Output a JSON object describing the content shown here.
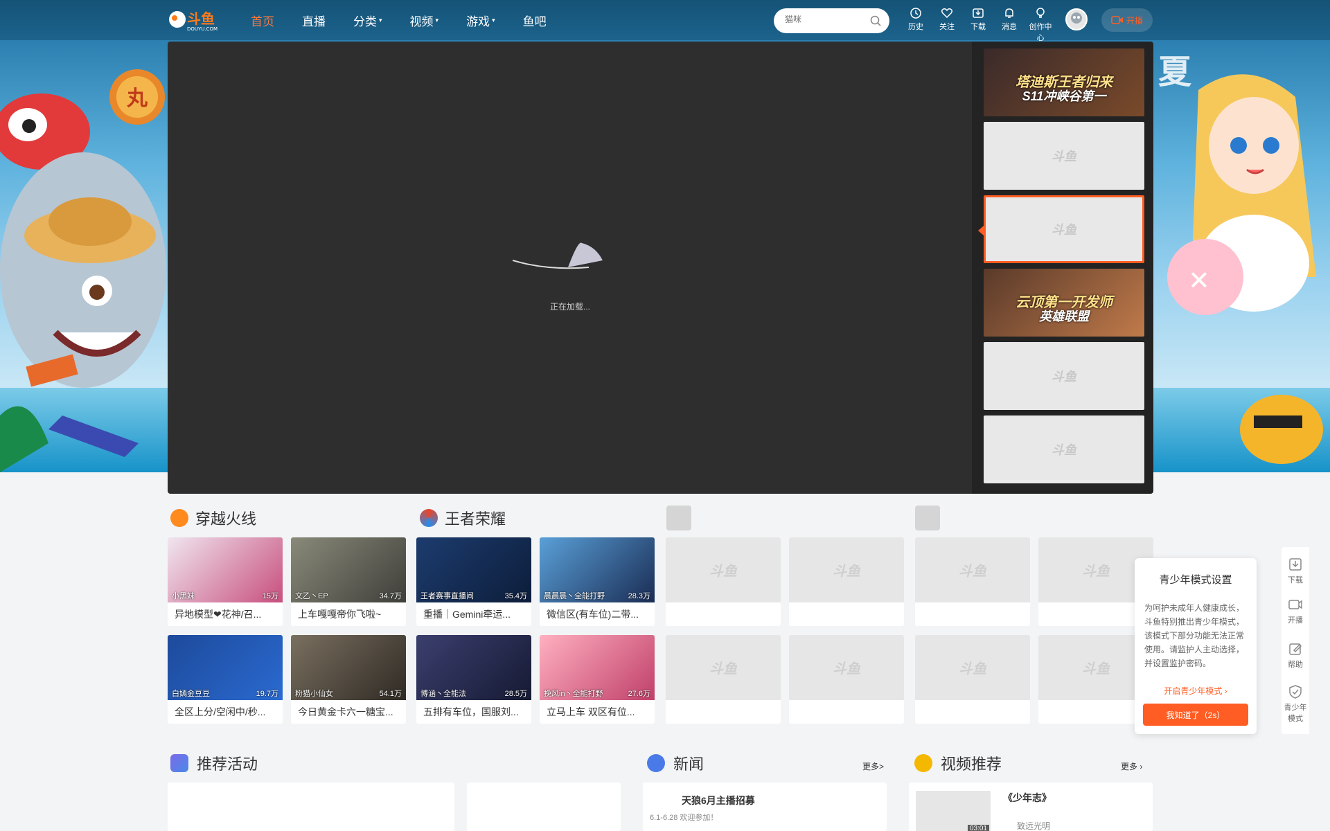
{
  "header": {
    "logo_text": "斗鱼",
    "logo_sub": "DOUYU.COM",
    "nav": [
      {
        "label": "首页",
        "active": true,
        "dropdown": false
      },
      {
        "label": "直播",
        "active": false,
        "dropdown": false
      },
      {
        "label": "分类",
        "active": false,
        "dropdown": true
      },
      {
        "label": "视频",
        "active": false,
        "dropdown": true
      },
      {
        "label": "游戏",
        "active": false,
        "dropdown": true
      },
      {
        "label": "鱼吧",
        "active": false,
        "dropdown": false
      }
    ],
    "search_placeholder": "猫咪",
    "icons": [
      {
        "label": "历史",
        "icon": "history-icon"
      },
      {
        "label": "关注",
        "icon": "heart-icon"
      },
      {
        "label": "下载",
        "icon": "download-icon"
      },
      {
        "label": "消息",
        "icon": "bell-icon"
      },
      {
        "label": "创作中心",
        "icon": "bulb-icon"
      }
    ],
    "live_button": "开播"
  },
  "player": {
    "loading_text": "正在加载..."
  },
  "side_list": [
    {
      "line1": "塔迪斯王者归来",
      "line2": "S11冲峡谷第一",
      "placeholder": false,
      "active": false
    },
    {
      "line1": "斗鱼",
      "line2": "",
      "placeholder": true,
      "active": false
    },
    {
      "line1": "斗鱼",
      "line2": "",
      "placeholder": true,
      "active": true
    },
    {
      "line1": "云顶第一开发师",
      "line2": "英雄联盟",
      "placeholder": false,
      "active": false
    },
    {
      "line1": "斗鱼",
      "line2": "",
      "placeholder": true,
      "active": false
    },
    {
      "line1": "斗鱼",
      "line2": "",
      "placeholder": true,
      "active": false
    }
  ],
  "categories": [
    {
      "name": "穿越火线",
      "icon_color": "#ff8a1e"
    },
    {
      "name": "王者荣耀",
      "icon_color": "#e8452b"
    },
    {
      "name": "",
      "icon_color": ""
    },
    {
      "name": "",
      "icon_color": ""
    }
  ],
  "streams": [
    {
      "name": "小黑妹",
      "hot": "15万",
      "title": "异地模型❤花神/召...",
      "color1": "#f0e6f0",
      "color2": "#c84f7e"
    },
    {
      "name": "文乙丶EP",
      "hot": "34.7万",
      "title": "上车嘎嘎帝你飞啦~",
      "color1": "#8a8a7a",
      "color2": "#3f3f3a"
    },
    {
      "name": "王者赛事直播间",
      "hot": "35.4万",
      "title": "重播｜Gemini牵运...",
      "color1": "#1c3c6e",
      "color2": "#0d1d3a"
    },
    {
      "name": "晨晨晨丶全能打野",
      "hot": "28.3万",
      "title": "微信区(有车位)二带...",
      "color1": "#5aa0d8",
      "color2": "#1a2c54"
    },
    {
      "name": "白嫣金豆豆",
      "hot": "19.7万",
      "title": "全区上分/空闲中/秒...",
      "color1": "#1d4a9b",
      "color2": "#2a6ad0"
    },
    {
      "name": "粉猫小仙女",
      "hot": "54.1万",
      "title": "今日黄金卡六一糖宝...",
      "color1": "#7a7060",
      "color2": "#2f2a24"
    },
    {
      "name": "博涵丶全能法",
      "hot": "28.5万",
      "title": "五排有车位，国服刘...",
      "color1": "#3b3f6e",
      "color2": "#161a33"
    },
    {
      "name": "挽风in丶全能打野",
      "hot": "27.6万",
      "title": "立马上车 双区有位...",
      "color1": "#ffb0c0",
      "color2": "#c0406a"
    }
  ],
  "teen_mode": {
    "title": "青少年模式设置",
    "desc": "为呵护未成年人健康成长，斗鱼特别推出青少年模式，该模式下部分功能无法正常使用。请监护人主动选择，并设置监护密码。",
    "link": "开启青少年模式 ›",
    "button": "我知道了（2s）"
  },
  "right_tools": [
    {
      "label": "下载",
      "icon": "download-icon"
    },
    {
      "label": "开播",
      "icon": "camera-icon"
    },
    {
      "label": "帮助",
      "icon": "edit-icon"
    },
    {
      "label": "青少年模式",
      "icon": "shield-icon"
    }
  ],
  "bottom": {
    "activities_title": "推荐活动",
    "news_title": "新闻",
    "news_more": "更多>",
    "news_item_title": "天狼6月主播招募",
    "news_item_sub": "6.1-6.28 欢迎参加！",
    "video_title": "视频推荐",
    "video_more": "更多 ›",
    "video_item_title": "《少年志》",
    "video_item_author": "致远光明",
    "video_item_duration": "03:01"
  },
  "colors": {
    "accent": "#ff5d23",
    "nav_active": "#ff7a3c"
  }
}
